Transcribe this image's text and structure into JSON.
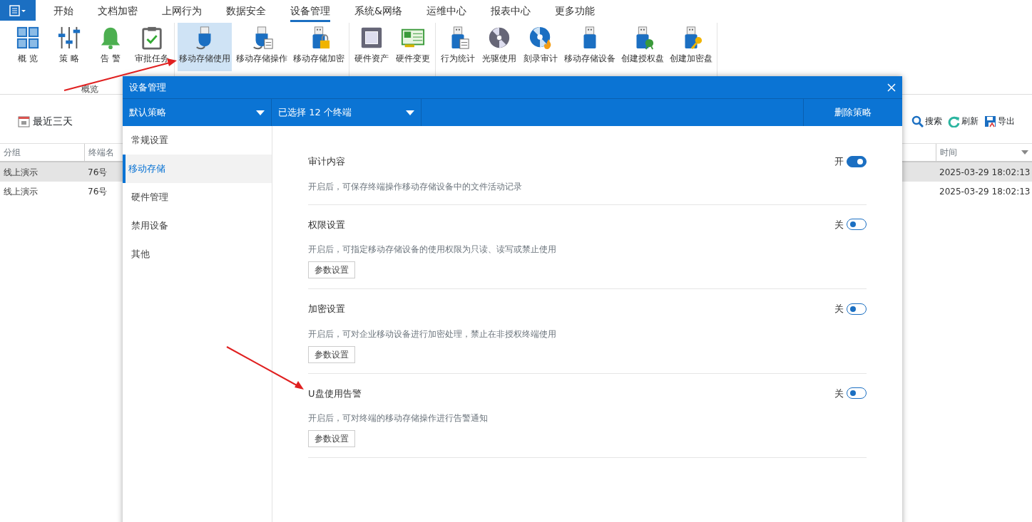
{
  "menu_tabs": [
    {
      "label": "开始",
      "selected": false
    },
    {
      "label": "文档加密",
      "selected": false
    },
    {
      "label": "上网行为",
      "selected": false
    },
    {
      "label": "数据安全",
      "selected": false
    },
    {
      "label": "设备管理",
      "selected": true
    },
    {
      "label": "系统&网络",
      "selected": false
    },
    {
      "label": "运维中心",
      "selected": false
    },
    {
      "label": "报表中心",
      "selected": false
    },
    {
      "label": "更多功能",
      "selected": false
    }
  ],
  "ribbon": {
    "groups": [
      {
        "label": "概览",
        "items": [
          {
            "label": "概 览",
            "selected": false
          },
          {
            "label": "策 略",
            "selected": false
          },
          {
            "label": "告 警",
            "selected": false
          },
          {
            "label": "审批任务",
            "selected": false
          }
        ]
      },
      {
        "items": [
          {
            "label": "移动存储使用",
            "selected": true
          },
          {
            "label": "移动存储操作",
            "selected": false
          },
          {
            "label": "移动存储加密",
            "selected": false
          }
        ]
      },
      {
        "items": [
          {
            "label": "硬件资产",
            "selected": false
          },
          {
            "label": "硬件变更",
            "selected": false
          }
        ]
      },
      {
        "items": [
          {
            "label": "行为统计",
            "selected": false
          },
          {
            "label": "光驱使用",
            "selected": false
          },
          {
            "label": "刻录审计",
            "selected": false
          },
          {
            "label": "移动存储设备",
            "selected": false
          },
          {
            "label": "创建授权盘",
            "selected": false
          },
          {
            "label": "创建加密盘",
            "selected": false
          }
        ]
      }
    ]
  },
  "toolbar": {
    "date_filter": "最近三天",
    "actions": [
      "搜索",
      "刷新",
      "导出"
    ]
  },
  "table": {
    "columns": [
      "分组",
      "终端名",
      "时间"
    ],
    "rows": [
      {
        "cells": [
          "线上演示",
          "76号",
          "2025-03-29 18:02:13"
        ],
        "selected": true
      },
      {
        "cells": [
          "线上演示",
          "76号",
          "2025-03-29 18:02:13"
        ],
        "selected": false
      }
    ]
  },
  "dialog": {
    "title": "设备管理",
    "policy_select": "默认策略",
    "terminal_select": "已选择 12 个终端",
    "delete_button": "删除策略",
    "nav": [
      {
        "label": "常规设置",
        "selected": false
      },
      {
        "label": "移动存储",
        "selected": true
      },
      {
        "label": "硬件管理",
        "selected": false
      },
      {
        "label": "禁用设备",
        "selected": false
      },
      {
        "label": "其他",
        "selected": false
      }
    ],
    "settings": [
      {
        "title": "审计内容",
        "state_label": "开",
        "on": true,
        "description": "开启后，可保存终端操作移动存储设备中的文件活动记录"
      },
      {
        "title": "权限设置",
        "state_label": "关",
        "on": false,
        "description": "开启后，可指定移动存储设备的使用权限为只读、读写或禁止使用",
        "button": "参数设置"
      },
      {
        "title": "加密设置",
        "state_label": "关",
        "on": false,
        "description": "开启后，可对企业移动设备进行加密处理，禁止在非授权终端使用",
        "button": "参数设置"
      },
      {
        "title": "U盘使用告警",
        "state_label": "关",
        "on": false,
        "description": "开启后，可对终端的移动存储操作进行告警通知",
        "button": "参数设置"
      }
    ]
  }
}
